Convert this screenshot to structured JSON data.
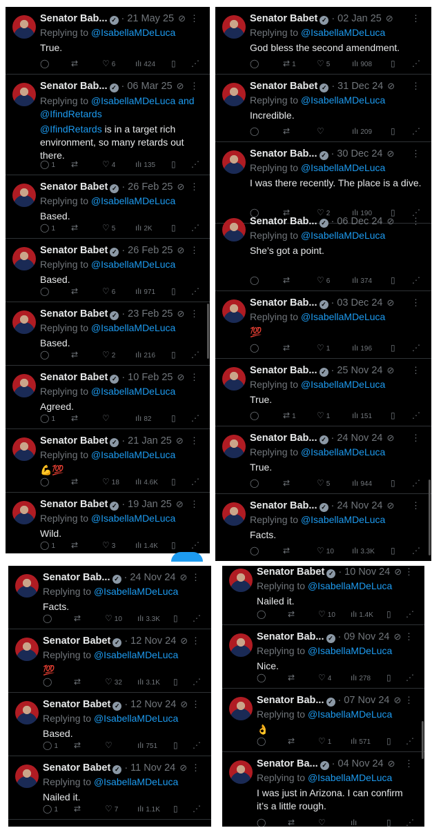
{
  "panels": [
    {
      "id": "panel-top-left",
      "tweets": [
        {
          "name": "Senator Bab...",
          "date": "21 May 25",
          "reply_prefix": "Replying to ",
          "handle": "@IsabellaMDeLuca",
          "reply_extra": "",
          "text": "True.",
          "replies": "",
          "retweets": "",
          "likes": "6",
          "views": "424"
        },
        {
          "name": "Senator Bab...",
          "date": "06 Mar 25",
          "reply_prefix": "Replying to ",
          "handle": "@IsabellaMDeLuca",
          "reply_extra": " and @IfindRetards",
          "text_mention": "@IfindRetards",
          "text": " is in a target rich environment, so many retards out there.",
          "replies": "1",
          "retweets": "",
          "likes": "4",
          "views": "135"
        },
        {
          "name": "Senator Babet",
          "date": "26 Feb 25",
          "reply_prefix": "Replying to ",
          "handle": "@IsabellaMDeLuca",
          "reply_extra": "",
          "text": "Based.",
          "replies": "1",
          "retweets": "",
          "likes": "5",
          "views": "2K"
        },
        {
          "name": "Senator Babet",
          "date": "26 Feb 25",
          "reply_prefix": "Replying to ",
          "handle": "@IsabellaMDeLuca",
          "reply_extra": "",
          "text": "Based.",
          "replies": "",
          "retweets": "",
          "likes": "6",
          "views": "971"
        },
        {
          "name": "Senator Babet",
          "date": "23 Feb 25",
          "reply_prefix": "Replying to ",
          "handle": "@IsabellaMDeLuca",
          "reply_extra": "",
          "text": "Based.",
          "replies": "",
          "retweets": "",
          "likes": "2",
          "views": "216"
        },
        {
          "name": "Senator Babet",
          "date": "10 Feb 25",
          "reply_prefix": "Replying to ",
          "handle": "@IsabellaMDeLuca",
          "reply_extra": "",
          "text": "Agreed.",
          "replies": "1",
          "retweets": "",
          "likes": "",
          "views": "82"
        },
        {
          "name": "Senator Babet",
          "date": "21 Jan 25",
          "reply_prefix": "Replying to ",
          "handle": "@IsabellaMDeLuca",
          "reply_extra": "",
          "text": "💪💯",
          "replies": "",
          "retweets": "",
          "likes": "18",
          "views": "4.6K"
        },
        {
          "name": "Senator Babet",
          "date": "19 Jan 25",
          "reply_prefix": "Replying to ",
          "handle": "@IsabellaMDeLuca",
          "reply_extra": "",
          "text": "Wild.",
          "replies": "1",
          "retweets": "",
          "likes": "3",
          "views": "1.4K"
        }
      ]
    },
    {
      "id": "panel-top-right",
      "tweets": [
        {
          "name": "Senator Babet",
          "date": "02 Jan 25",
          "reply_prefix": "Replying to ",
          "handle": "@IsabellaMDeLuca",
          "reply_extra": "",
          "text": "God bless the second amendment.",
          "replies": "",
          "retweets": "1",
          "likes": "5",
          "views": "908"
        },
        {
          "name": "Senator Babet",
          "date": "31 Dec 24",
          "reply_prefix": "Replying to ",
          "handle": "@IsabellaMDeLuca",
          "reply_extra": "",
          "text": "Incredible.",
          "replies": "",
          "retweets": "",
          "likes": "",
          "views": "209"
        },
        {
          "name": "Senator Bab...",
          "date": "30 Dec 24",
          "reply_prefix": "Replying to ",
          "handle": "@IsabellaMDeLuca",
          "reply_extra": "",
          "text": "I was there recently. The place is a dive.",
          "replies": "",
          "retweets": "",
          "likes": "2",
          "views": "190"
        },
        {
          "name": "Senator Bab...",
          "date": "06 Dec 24",
          "reply_prefix": "Replying to ",
          "handle": "@IsabellaMDeLuca",
          "reply_extra": "",
          "text": "She’s got a point.",
          "replies": "",
          "retweets": "",
          "likes": "6",
          "views": "374"
        },
        {
          "name": "Senator Bab...",
          "date": "03 Dec 24",
          "reply_prefix": "Replying to ",
          "handle": "@IsabellaMDeLuca",
          "reply_extra": "",
          "text": "💯",
          "replies": "",
          "retweets": "",
          "likes": "1",
          "views": "196"
        },
        {
          "name": "Senator Bab...",
          "date": "25 Nov 24",
          "reply_prefix": "Replying to ",
          "handle": "@IsabellaMDeLuca",
          "reply_extra": "",
          "text": "True.",
          "replies": "",
          "retweets": "1",
          "likes": "1",
          "views": "151"
        },
        {
          "name": "Senator Bab...",
          "date": "24 Nov 24",
          "reply_prefix": "Replying to ",
          "handle": "@IsabellaMDeLuca",
          "reply_extra": "",
          "text": "True.",
          "replies": "",
          "retweets": "",
          "likes": "5",
          "views": "944"
        },
        {
          "name": "Senator Bab...",
          "date": "24 Nov 24",
          "reply_prefix": "Replying to ",
          "handle": "@IsabellaMDeLuca",
          "reply_extra": "",
          "text": "Facts.",
          "replies": "",
          "retweets": "",
          "likes": "10",
          "views": "3.3K"
        }
      ]
    },
    {
      "id": "panel-bottom-left",
      "tweets": [
        {
          "name": "Senator Bab...",
          "date": "24 Nov 24",
          "reply_prefix": "Replying to ",
          "handle": "@IsabellaMDeLuca",
          "reply_extra": "",
          "text": "Facts.",
          "replies": "",
          "retweets": "",
          "likes": "10",
          "views": "3.3K"
        },
        {
          "name": "Senator Babet",
          "date": "12 Nov 24",
          "reply_prefix": "Replying to ",
          "handle": "@IsabellaMDeLuca",
          "reply_extra": "",
          "text": "💯",
          "replies": "",
          "retweets": "",
          "likes": "32",
          "views": "3.1K"
        },
        {
          "name": "Senator Babet",
          "date": "12 Nov 24",
          "reply_prefix": "Replying to ",
          "handle": "@IsabellaMDeLuca",
          "reply_extra": "",
          "text": "Based.",
          "replies": "1",
          "retweets": "",
          "likes": "",
          "views": "751"
        },
        {
          "name": "Senator Babet",
          "date": "11 Nov 24",
          "reply_prefix": "Replying to ",
          "handle": "@IsabellaMDeLuca",
          "reply_extra": "",
          "text": "Nailed it.",
          "replies": "1",
          "retweets": "",
          "likes": "7",
          "views": "1.1K"
        }
      ]
    },
    {
      "id": "panel-bottom-right",
      "tweets": [
        {
          "name": "Senator Babet",
          "date": "10 Nov 24",
          "reply_prefix": "Replying to ",
          "handle": "@IsabellaMDeLuca",
          "reply_extra": "",
          "text": "Nailed it.",
          "replies": "",
          "retweets": "",
          "likes": "10",
          "views": "1.4K"
        },
        {
          "name": "Senator Bab...",
          "date": "09 Nov 24",
          "reply_prefix": "Replying to ",
          "handle": "@IsabellaMDeLuca",
          "reply_extra": "",
          "text": "Nice.",
          "replies": "",
          "retweets": "",
          "likes": "4",
          "views": "278"
        },
        {
          "name": "Senator Bab...",
          "date": "07 Nov 24",
          "reply_prefix": "Replying to ",
          "handle": "@IsabellaMDeLuca",
          "reply_extra": "",
          "text": "👌",
          "replies": "",
          "retweets": "",
          "likes": "1",
          "views": "571"
        },
        {
          "name": "Senator Ba...",
          "date": "04 Nov 24",
          "reply_prefix": "Replying to ",
          "handle": "@IsabellaMDeLuca",
          "reply_extra": "",
          "text": "I was just in Arizona. I can confirm it’s a little rough.",
          "replies": "",
          "retweets": "",
          "likes": "",
          "views": ""
        }
      ]
    }
  ],
  "icons": {
    "reply": "reply-icon",
    "retweet": "retweet-icon",
    "like": "heart-icon",
    "views": "views-icon",
    "bookmark": "bookmark-icon",
    "share": "share-icon",
    "grok": "grok-icon",
    "more": "more-icon",
    "verified": "verified-badge-icon"
  },
  "colors": {
    "background": "#000000",
    "text": "#e7e9ea",
    "muted": "#71767b",
    "link": "#1d9bf0",
    "divider": "#2f3336"
  }
}
